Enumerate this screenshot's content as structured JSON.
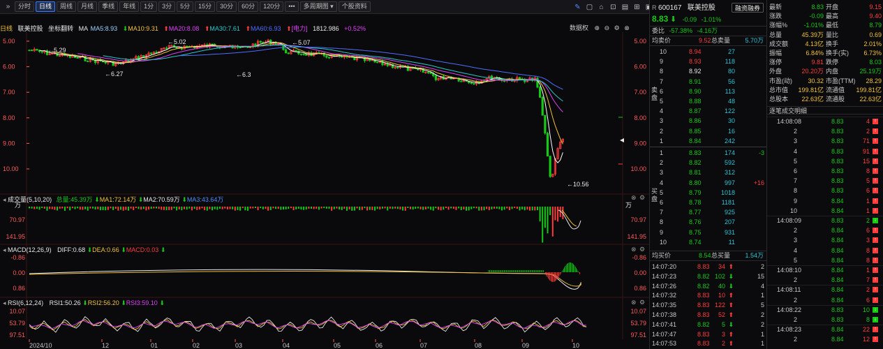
{
  "toolbar": {
    "expand_label": "»",
    "buttons": [
      "分时",
      "日线",
      "周线",
      "月线",
      "季线",
      "年线",
      "1分",
      "3分",
      "5分",
      "15分",
      "30分",
      "60分",
      "120分"
    ],
    "active_index": 1,
    "more_label": "•••",
    "multi_period_label": "多周期图",
    "profile_label": "个股资料"
  },
  "legend": {
    "period": "日线",
    "name": "联美控股",
    "adjust": "坐标翻转",
    "ma_label": "MA",
    "ma5": "MA5:8.93",
    "ma10": "MA10:9.31",
    "ma20": "MA20:8.08",
    "ma30": "MA30:7.61",
    "ma60": "MA60:6.93",
    "sector": "[电力]",
    "sector_value": "1812.986",
    "sector_change": "+0.52%",
    "restore_label": "数据权"
  },
  "price_axis": [
    "5.00",
    "6.00",
    "7.00",
    "8.00",
    "9.00",
    "10.00"
  ],
  "price_annotations": {
    "high1": "5.02",
    "high2": "5.07",
    "low1": "6.27",
    "low2": "6.3",
    "mark1": "5.29",
    "mark2": "10.56"
  },
  "volume": {
    "title": "成交量(5,10,20)",
    "total": "总量:45.39万",
    "ma1": "MA1:72.14万",
    "ma2": "MA2:70.59万",
    "ma3": "MA3:43.64万",
    "unit": "万",
    "axis": [
      "70.97",
      "141.95"
    ]
  },
  "macd": {
    "title": "MACD(12,26,9)",
    "diff": "DIFF:0.68",
    "dea": "DEA:0.66",
    "macd": "MACD:0.03",
    "axis": [
      "-0.86",
      "0.00",
      "0.86"
    ]
  },
  "rsi": {
    "title": "RSI(6,12,24)",
    "rsi1": "RSI1:50.26",
    "rsi2": "RSI2:56.20",
    "rsi3": "RSI3:59.10",
    "axis": [
      "10.07",
      "53.79",
      "97.51"
    ]
  },
  "time_axis": [
    "2024/10",
    "12",
    "01",
    "02",
    "03",
    "04",
    "05",
    "06",
    "07",
    "08",
    "09",
    "10"
  ],
  "quote": {
    "code": "600167",
    "code_prefix": "R",
    "name": "联美控股",
    "financing_label": "融资融券",
    "price": "8.83",
    "change": "-0.09",
    "change_pct": "-1.01%",
    "wei_bi_label": "委比",
    "wei_bi": "-57.38%",
    "wei_cha": "-4.16万",
    "avg_ask_label": "均卖价",
    "avg_ask": "9.52",
    "total_ask_label": "总卖量",
    "total_ask": "5.70万",
    "sell_side_label": "卖盘",
    "buy_side_label": "买盘",
    "asks": [
      {
        "level": "10",
        "price": "8.94",
        "vol": "27"
      },
      {
        "level": "9",
        "price": "8.93",
        "vol": "118"
      },
      {
        "level": "8",
        "price": "8.92",
        "vol": "80"
      },
      {
        "level": "7",
        "price": "8.91",
        "vol": "56"
      },
      {
        "level": "6",
        "price": "8.90",
        "vol": "113"
      },
      {
        "level": "5",
        "price": "8.88",
        "vol": "48"
      },
      {
        "level": "4",
        "price": "8.87",
        "vol": "122"
      },
      {
        "level": "3",
        "price": "8.86",
        "vol": "30"
      },
      {
        "level": "2",
        "price": "8.85",
        "vol": "16"
      },
      {
        "level": "1",
        "price": "8.84",
        "vol": "242"
      }
    ],
    "bids": [
      {
        "level": "1",
        "price": "8.83",
        "vol": "174",
        "delta": "-3"
      },
      {
        "level": "2",
        "price": "8.82",
        "vol": "592",
        "delta": ""
      },
      {
        "level": "3",
        "price": "8.81",
        "vol": "312",
        "delta": ""
      },
      {
        "level": "4",
        "price": "8.80",
        "vol": "997",
        "delta": "+16"
      },
      {
        "level": "5",
        "price": "8.79",
        "vol": "1018",
        "delta": ""
      },
      {
        "level": "6",
        "price": "8.78",
        "vol": "1181",
        "delta": ""
      },
      {
        "level": "7",
        "price": "8.77",
        "vol": "925",
        "delta": ""
      },
      {
        "level": "8",
        "price": "8.76",
        "vol": "207",
        "delta": ""
      },
      {
        "level": "9",
        "price": "8.75",
        "vol": "931",
        "delta": ""
      },
      {
        "level": "10",
        "price": "8.74",
        "vol": "11",
        "delta": ""
      }
    ],
    "avg_bid_label": "均买价",
    "avg_bid": "8.54",
    "total_bid_label": "总买量",
    "total_bid": "1.54万",
    "ticks": [
      {
        "time": "14:07:20",
        "price": "8.83",
        "vol": "34",
        "dir": "up",
        "n": "2"
      },
      {
        "time": "14:07:23",
        "price": "8.82",
        "vol": "102",
        "dir": "down",
        "n": "15"
      },
      {
        "time": "14:07:26",
        "price": "8.82",
        "vol": "40",
        "dir": "down",
        "n": "4"
      },
      {
        "time": "14:07:32",
        "price": "8.83",
        "vol": "10",
        "dir": "up",
        "n": "1"
      },
      {
        "time": "14:07:35",
        "price": "8.83",
        "vol": "122",
        "dir": "up",
        "n": "5"
      },
      {
        "time": "14:07:38",
        "price": "8.83",
        "vol": "52",
        "dir": "up",
        "n": "2"
      },
      {
        "time": "14:07:41",
        "price": "8.82",
        "vol": "5",
        "dir": "down",
        "n": "2"
      },
      {
        "time": "14:07:47",
        "price": "8.83",
        "vol": "3",
        "dir": "up",
        "n": "1"
      },
      {
        "time": "14:07:53",
        "price": "8.83",
        "vol": "2",
        "dir": "up",
        "n": "1"
      }
    ]
  },
  "stats": {
    "rows": [
      {
        "l1": "最新",
        "v1": "8.83",
        "c1": "green",
        "l2": "开盘",
        "v2": "9.15",
        "c2": "red"
      },
      {
        "l1": "涨跌",
        "v1": "-0.09",
        "c1": "green",
        "l2": "最高",
        "v2": "9.40",
        "c2": "red"
      },
      {
        "l1": "涨幅%",
        "v1": "-1.01%",
        "c1": "green",
        "l2": "最低",
        "v2": "8.79",
        "c2": "green"
      },
      {
        "l1": "总量",
        "v1": "45.39万",
        "c1": "yellow",
        "l2": "量比",
        "v2": "0.69",
        "c2": "yellow"
      },
      {
        "l1": "成交额",
        "v1": "4.13亿",
        "c1": "yellow",
        "l2": "换手",
        "v2": "2.01%",
        "c2": "yellow"
      },
      {
        "l1": "振幅",
        "v1": "6.84%",
        "c1": "yellow",
        "l2": "换手(实)",
        "v2": "6.73%",
        "c2": "yellow"
      },
      {
        "l1": "涨停",
        "v1": "9.81",
        "c1": "red",
        "l2": "跌停",
        "v2": "8.03",
        "c2": "green"
      },
      {
        "l1": "外盘",
        "v1": "20.20万",
        "c1": "red",
        "l2": "内盘",
        "v2": "25.19万",
        "c2": "green"
      },
      {
        "l1": "市盈(动)",
        "v1": "30.32",
        "c1": "yellow",
        "l2": "市盈(TTM)",
        "v2": "28.29",
        "c2": "yellow"
      },
      {
        "l1": "总市值",
        "v1": "199.81亿",
        "c1": "yellow",
        "l2": "流通值",
        "v2": "199.81亿",
        "c2": "yellow"
      },
      {
        "l1": "总股本",
        "v1": "22.63亿",
        "c1": "yellow",
        "l2": "流通股",
        "v2": "22.63亿",
        "c2": "yellow"
      }
    ],
    "detail_title": "逐笔成交明细",
    "details": [
      {
        "time": "14:08:08",
        "price": "8.83",
        "vol": "4",
        "dir": "up"
      },
      {
        "time": "",
        "price": "8.83",
        "vol": "2",
        "dir": "up",
        "idx": "2"
      },
      {
        "time": "",
        "price": "8.83",
        "vol": "71",
        "dir": "up",
        "idx": "3"
      },
      {
        "time": "",
        "price": "8.83",
        "vol": "91",
        "dir": "up",
        "idx": "4"
      },
      {
        "time": "",
        "price": "8.83",
        "vol": "15",
        "dir": "up",
        "idx": "5"
      },
      {
        "time": "",
        "price": "8.83",
        "vol": "8",
        "dir": "up",
        "idx": "6"
      },
      {
        "time": "",
        "price": "8.83",
        "vol": "5",
        "dir": "up",
        "idx": "7"
      },
      {
        "time": "",
        "price": "8.83",
        "vol": "6",
        "dir": "up",
        "idx": "8"
      },
      {
        "time": "",
        "price": "8.84",
        "vol": "1",
        "dir": "up",
        "idx": "9"
      },
      {
        "time": "",
        "price": "8.84",
        "vol": "1",
        "dir": "up",
        "idx": "10"
      },
      {
        "time": "14:08:09",
        "price": "8.83",
        "vol": "2",
        "dir": "down"
      },
      {
        "time": "",
        "price": "8.84",
        "vol": "6",
        "dir": "up",
        "idx": "2"
      },
      {
        "time": "",
        "price": "8.84",
        "vol": "3",
        "dir": "up",
        "idx": "3"
      },
      {
        "time": "",
        "price": "8.84",
        "vol": "8",
        "dir": "up",
        "idx": "4"
      },
      {
        "time": "",
        "price": "8.84",
        "vol": "8",
        "dir": "up",
        "idx": "5"
      },
      {
        "time": "14:08:10",
        "price": "8.84",
        "vol": "1",
        "dir": "up"
      },
      {
        "time": "",
        "price": "8.84",
        "vol": "7",
        "dir": "up",
        "idx": "2"
      },
      {
        "time": "14:08:11",
        "price": "8.84",
        "vol": "2",
        "dir": "up"
      },
      {
        "time": "",
        "price": "8.84",
        "vol": "6",
        "dir": "up",
        "idx": "2"
      },
      {
        "time": "14:08:22",
        "price": "8.83",
        "vol": "10",
        "dir": "down"
      },
      {
        "time": "",
        "price": "8.83",
        "vol": "8",
        "dir": "down",
        "idx": "2"
      },
      {
        "time": "14:08:23",
        "price": "8.84",
        "vol": "22",
        "dir": "up"
      },
      {
        "time": "",
        "price": "8.84",
        "vol": "12",
        "dir": "up",
        "idx": "2"
      }
    ]
  },
  "colors": {
    "up": "#ff3b3b",
    "down": "#17c917",
    "ma5": "#ffffff",
    "ma10": "#f0c23c",
    "ma20": "#e040fb",
    "ma30": "#27c8c8",
    "ma60": "#4d6dff"
  }
}
